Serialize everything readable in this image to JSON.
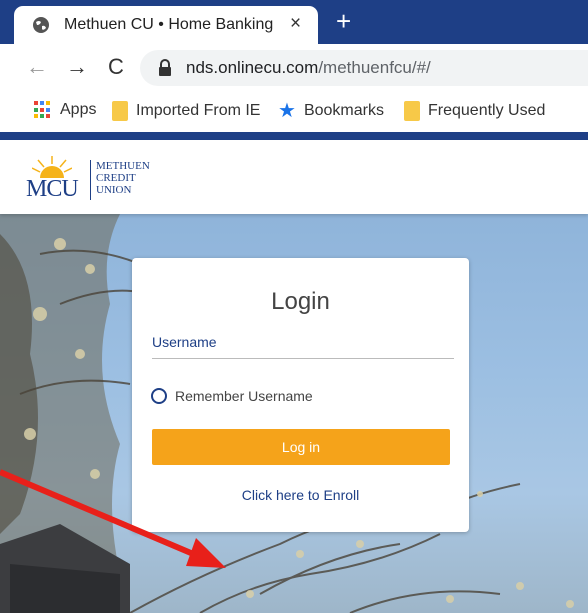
{
  "browser": {
    "tab_title": "Methuen CU • Home Banking",
    "tab_close": "×",
    "new_tab": "+",
    "url_host": "nds.onlinecu.com",
    "url_path": "/methuenfcu/#/",
    "nav": {
      "back": "←",
      "forward": "→",
      "reload": "C"
    },
    "bookmarks": [
      {
        "label": "Apps",
        "icon": "apps-grid-icon"
      },
      {
        "label": "Imported From IE",
        "icon": "folder-icon"
      },
      {
        "label": "Bookmarks",
        "icon": "star-icon"
      },
      {
        "label": "Frequently Used",
        "icon": "folder-icon"
      }
    ]
  },
  "site": {
    "logo_mark": "MCU",
    "logo_words": [
      "METHUEN",
      "CREDIT",
      "UNION"
    ]
  },
  "login": {
    "title": "Login",
    "username_label": "Username",
    "remember_label": "Remember Username",
    "login_button": "Log in",
    "enroll_link": "Click here to Enroll"
  },
  "colors": {
    "brand_blue": "#1e3f86",
    "login_orange": "#f5a31a",
    "annotation_red": "#e8201a"
  }
}
